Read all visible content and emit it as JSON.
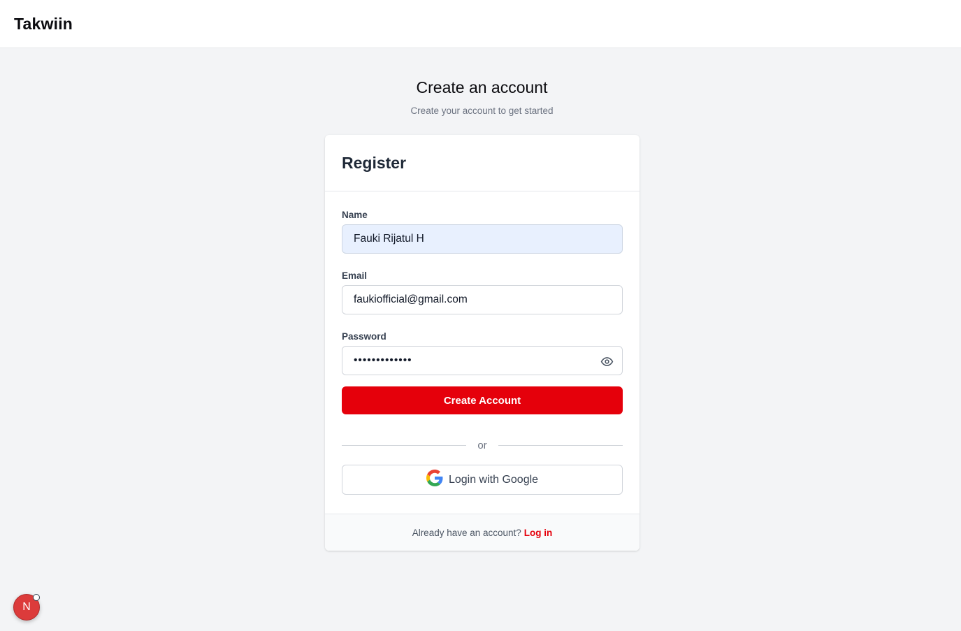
{
  "header": {
    "brand": "Takwiin"
  },
  "page": {
    "title": "Create an account",
    "subtitle": "Create your account to get started"
  },
  "card": {
    "title": "Register",
    "name": {
      "label": "Name",
      "value": "Fauki Rijatul H"
    },
    "email": {
      "label": "Email",
      "value": "faukiofficial@gmail.com"
    },
    "password": {
      "label": "Password",
      "value": "•••••••••••••",
      "toggle_icon": "eye-icon"
    },
    "submit_label": "Create Account",
    "divider_label": "or",
    "google_label": "Login with Google",
    "footer": {
      "prompt": "Already have an account?",
      "link": "Log in"
    }
  },
  "dev_badge": {
    "letter": "N"
  },
  "colors": {
    "accent": "#e5000b",
    "background": "#f3f4f6",
    "autofill": "#e8f0fe"
  }
}
